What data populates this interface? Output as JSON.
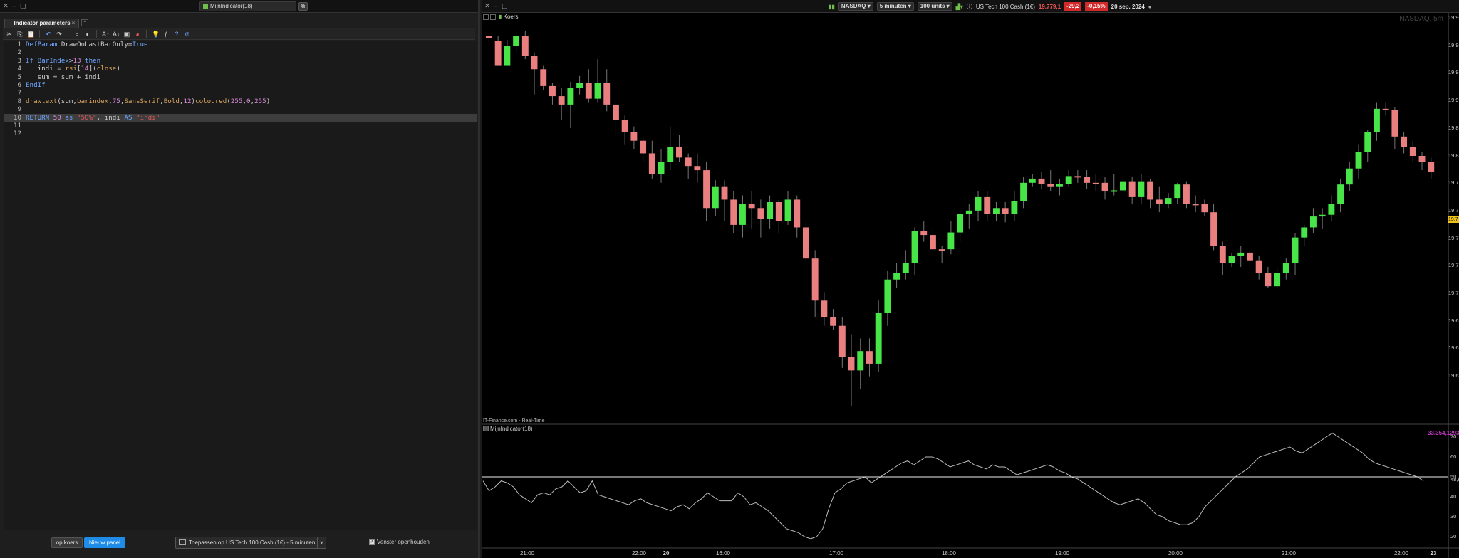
{
  "left_window": {
    "title": "MijnIndicator(18)",
    "panel_tab": "Indicator parameters",
    "code_lines": [
      "DefParam DrawOnLastBarOnly=True",
      "",
      "If BarIndex>13 then",
      "   indi = rsi[14](close)",
      "   sum = sum + indi",
      "EndIf",
      "",
      "drawtext(sum,barindex,75,SansSerif,Bold,12)coloured(255,0,255)",
      "",
      "RETURN 50 as \"50%\", indi AS \"indi\"",
      "",
      ""
    ],
    "op_koers_label": "op koers",
    "nieuw_panel_label": "Nieuw panel",
    "apply_label": "Toepassen op US Tech 100 Cash (1€) - 5 minuten",
    "venster_label": "Venster openhouden"
  },
  "right_window": {
    "exchange": "NASDAQ",
    "timeframe": "5 minuten",
    "units": "100 units",
    "instrument": "US Tech 100 Cash (1€)",
    "price": "19.779,1",
    "change": "-29,2",
    "change_pct": "-0,15%",
    "date": "20 sep. 2024",
    "koers_label": "Koers",
    "watermark": "NASDAQ, 5m",
    "source": "IT-Finance.com - Real-Time",
    "indicator_name": "MijnIndicator(18)",
    "indicator_value": "33.354,129326",
    "price_badge": "19.7",
    "price_axis": [
      "19.9",
      "19.9",
      "19.9",
      "19.9",
      "19.8",
      "19.8",
      "19.7",
      "19.7",
      "19.7",
      "19.7",
      "19.7",
      "19.6",
      "19.6",
      "19.6"
    ],
    "ind_axis": [
      "70",
      "60",
      "50",
      "48,6",
      "40",
      "30",
      "20"
    ],
    "time_axis": [
      {
        "label": "21:00",
        "bold": false
      },
      {
        "label": "22:00",
        "bold": false
      },
      {
        "label": "20",
        "bold": true
      },
      {
        "label": "16:00",
        "bold": false
      },
      {
        "label": "17:00",
        "bold": false
      },
      {
        "label": "18:00",
        "bold": false
      },
      {
        "label": "19:00",
        "bold": false
      },
      {
        "label": "20:00",
        "bold": false
      },
      {
        "label": "21:00",
        "bold": false
      },
      {
        "label": "22:00",
        "bold": false
      },
      {
        "label": "23",
        "bold": true
      }
    ]
  },
  "colors": {
    "up": "#47e547",
    "down": "#ea7f7f",
    "accent": "#1f8ce8",
    "indicator_text": "#c436c4"
  },
  "chart_data": [
    {
      "type": "candlestick",
      "title": "Koers",
      "candles": [
        [
          0,
          3,
          0,
          8
        ],
        [
          6,
          36,
          0,
          36
        ],
        [
          36,
          12,
          5,
          36
        ],
        [
          12,
          0,
          -3,
          20
        ],
        [
          0,
          24,
          -6,
          28
        ],
        [
          24,
          40,
          20,
          70
        ],
        [
          40,
          60,
          36,
          65
        ],
        [
          60,
          72,
          56,
          82
        ],
        [
          72,
          82,
          62,
          100
        ],
        [
          82,
          62,
          55,
          110
        ],
        [
          62,
          56,
          48,
          70
        ],
        [
          56,
          75,
          40,
          80
        ],
        [
          75,
          56,
          28,
          80
        ],
        [
          56,
          82,
          40,
          90
        ],
        [
          82,
          100,
          78,
          120
        ],
        [
          100,
          115,
          95,
          130
        ],
        [
          115,
          125,
          108,
          135
        ],
        [
          125,
          140,
          120,
          150
        ],
        [
          140,
          165,
          125,
          170
        ],
        [
          165,
          150,
          135,
          175
        ],
        [
          150,
          132,
          108,
          160
        ],
        [
          132,
          145,
          118,
          150
        ],
        [
          145,
          155,
          140,
          170
        ],
        [
          155,
          160,
          140,
          175
        ],
        [
          160,
          205,
          150,
          220
        ],
        [
          205,
          180,
          172,
          215
        ],
        [
          180,
          195,
          172,
          220
        ],
        [
          195,
          225,
          185,
          235
        ],
        [
          225,
          200,
          190,
          240
        ],
        [
          200,
          205,
          185,
          230
        ],
        [
          205,
          218,
          195,
          240
        ],
        [
          218,
          198,
          190,
          230
        ],
        [
          198,
          220,
          195,
          235
        ],
        [
          220,
          195,
          185,
          225
        ],
        [
          195,
          228,
          190,
          240
        ],
        [
          228,
          265,
          220,
          270
        ],
        [
          265,
          315,
          255,
          335
        ],
        [
          315,
          335,
          305,
          345
        ],
        [
          335,
          345,
          325,
          350
        ],
        [
          345,
          382,
          335,
          395
        ],
        [
          382,
          398,
          355,
          440
        ],
        [
          398,
          375,
          360,
          420
        ],
        [
          375,
          390,
          360,
          405
        ],
        [
          390,
          330,
          315,
          400
        ],
        [
          330,
          290,
          280,
          345
        ],
        [
          290,
          282,
          270,
          300
        ],
        [
          282,
          270,
          255,
          290
        ],
        [
          270,
          232,
          228,
          285
        ],
        [
          232,
          237,
          220,
          245
        ],
        [
          237,
          254,
          228,
          260
        ],
        [
          254,
          254,
          250,
          270
        ],
        [
          254,
          234,
          220,
          260
        ],
        [
          234,
          212,
          208,
          245
        ],
        [
          212,
          208,
          200,
          230
        ],
        [
          208,
          192,
          185,
          220
        ],
        [
          192,
          212,
          185,
          220
        ],
        [
          212,
          205,
          198,
          220
        ],
        [
          205,
          212,
          198,
          222
        ],
        [
          212,
          197,
          185,
          220
        ],
        [
          197,
          175,
          168,
          205
        ],
        [
          175,
          170,
          165,
          180
        ],
        [
          170,
          176,
          162,
          182
        ],
        [
          176,
          180,
          160,
          185
        ],
        [
          180,
          176,
          170,
          190
        ],
        [
          176,
          167,
          160,
          180
        ],
        [
          167,
          168,
          160,
          175
        ],
        [
          168,
          175,
          160,
          182
        ],
        [
          175,
          175,
          165,
          185
        ],
        [
          175,
          185,
          168,
          195
        ],
        [
          185,
          184,
          165,
          190
        ],
        [
          184,
          174,
          165,
          186
        ],
        [
          174,
          192,
          168,
          200
        ],
        [
          192,
          174,
          165,
          200
        ],
        [
          174,
          195,
          170,
          205
        ],
        [
          195,
          200,
          180,
          210
        ],
        [
          200,
          193,
          187,
          205
        ],
        [
          193,
          177,
          175,
          200
        ],
        [
          177,
          200,
          174,
          205
        ],
        [
          200,
          200,
          190,
          210
        ],
        [
          200,
          210,
          195,
          215
        ],
        [
          210,
          250,
          200,
          255
        ],
        [
          250,
          270,
          245,
          285
        ],
        [
          270,
          262,
          258,
          275
        ],
        [
          262,
          258,
          250,
          275
        ],
        [
          258,
          268,
          255,
          275
        ],
        [
          268,
          282,
          262,
          290
        ],
        [
          282,
          298,
          275,
          300
        ],
        [
          298,
          282,
          275,
          300
        ],
        [
          282,
          270,
          265,
          290
        ],
        [
          270,
          240,
          235,
          285
        ],
        [
          240,
          228,
          225,
          250
        ],
        [
          228,
          215,
          205,
          235
        ],
        [
          215,
          213,
          205,
          230
        ],
        [
          213,
          200,
          190,
          220
        ],
        [
          200,
          177,
          170,
          210
        ],
        [
          177,
          158,
          150,
          185
        ],
        [
          158,
          138,
          130,
          170
        ],
        [
          138,
          115,
          112,
          150
        ],
        [
          115,
          87,
          80,
          125
        ],
        [
          87,
          88,
          80,
          95
        ],
        [
          88,
          120,
          85,
          135
        ],
        [
          120,
          132,
          115,
          140
        ],
        [
          132,
          143,
          125,
          150
        ],
        [
          143,
          150,
          138,
          160
        ],
        [
          150,
          162,
          145,
          170
        ]
      ],
      "ylim": [
        0,
        440
      ]
    },
    {
      "type": "line",
      "title": "MijnIndicator(18)",
      "series": [
        {
          "name": "indi",
          "values": [
            48,
            43,
            45,
            48,
            47,
            45,
            41,
            39,
            37,
            41,
            42,
            41,
            44,
            45,
            48,
            45,
            42,
            43,
            48,
            41,
            40,
            39,
            38,
            37,
            36,
            38,
            39,
            37,
            36,
            35,
            34,
            33,
            35,
            36,
            34,
            37,
            39,
            42,
            40,
            38,
            38,
            38,
            42,
            40,
            36,
            37,
            35,
            33,
            30,
            27,
            24,
            23,
            22,
            20,
            19,
            20,
            24,
            34,
            42,
            44,
            47,
            48,
            49,
            50,
            47,
            49,
            51,
            53,
            55,
            57,
            58,
            56,
            58,
            60,
            60,
            59,
            57,
            55,
            56,
            57,
            58,
            56,
            55,
            54,
            56,
            55,
            55,
            53,
            51,
            52,
            53,
            54,
            55,
            56,
            55,
            53,
            52,
            50,
            49,
            47,
            45,
            43,
            41,
            39,
            37,
            36,
            37,
            38,
            39,
            37,
            34,
            31,
            30,
            28,
            27,
            26,
            26,
            27,
            30,
            35,
            38,
            41,
            44,
            47,
            50,
            52,
            54,
            57,
            60,
            61,
            62,
            63,
            64,
            65,
            63,
            62,
            64,
            66,
            68,
            70,
            72,
            70,
            68,
            66,
            64,
            62,
            59,
            57,
            56,
            55,
            54,
            53,
            52,
            51,
            50,
            48
          ]
        },
        {
          "name": "50%",
          "values": [
            50,
            50
          ]
        }
      ],
      "ylim": [
        15,
        75
      ]
    }
  ]
}
